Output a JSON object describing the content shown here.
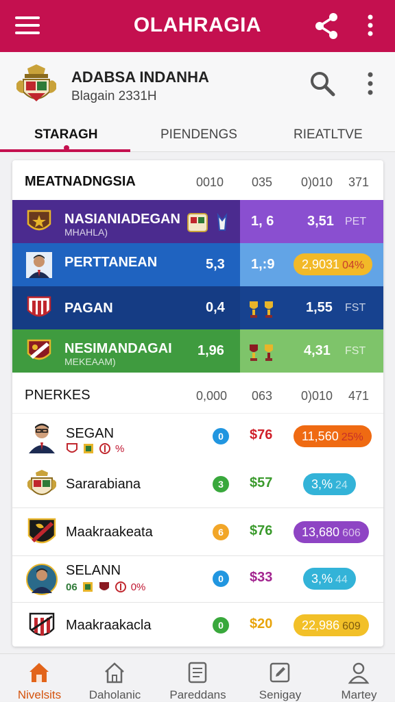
{
  "app_bar": {
    "title": "OLAHRAGIA",
    "icons": [
      "menu-icon",
      "share-icon",
      "more-vert-icon"
    ]
  },
  "profile": {
    "name": "ADABSA INDANHA",
    "subtitle": "Blagain 2331H",
    "icons": [
      "crest-icon",
      "search-icon",
      "more-vert-icon"
    ]
  },
  "tabs": [
    {
      "label": "STARAGH",
      "active": true
    },
    {
      "label": "PIENDENGS",
      "active": false
    },
    {
      "label": "RIEATLTVE",
      "active": false
    }
  ],
  "teams_section": {
    "header": "MEATNADNGSIA",
    "cols": [
      "0010",
      "035",
      "0)010",
      "371"
    ],
    "rows": [
      {
        "name": "NASIANIADEGAN",
        "sub": "MHAHLA)",
        "v1": "",
        "v2": "1, 6",
        "v3": "3,51",
        "v4": "PET",
        "color_left": "#4b2b8f",
        "color_right": "#8a4fd0"
      },
      {
        "name": "PERTTANEAN",
        "sub": "",
        "v1": "5,3",
        "v2": "1,:9",
        "v3": "2,9031",
        "v4": "04%",
        "color_left": "#1f63c0",
        "color_right": "#62a4e6"
      },
      {
        "name": "PAGAN",
        "sub": "",
        "v1": "0,4",
        "v2": "",
        "v3": "1,55",
        "v4": "FST",
        "color_left": "#153c84",
        "color_right": "#17428f"
      },
      {
        "name": "NESIMANDAGAI",
        "sub": "MEKEAAM)",
        "v1": "1,96",
        "v2": "",
        "v3": "4,31",
        "v4": "FST",
        "color_left": "#3f9b3f",
        "color_right": "#7ec46a"
      }
    ]
  },
  "players_section": {
    "header": "PNERKES",
    "cols": [
      "0,000",
      "063",
      "0)010",
      "471"
    ],
    "rows": [
      {
        "name": "SEGAN",
        "extras": "%",
        "circle": "0",
        "circle_color": "#2196e0",
        "money": "$76",
        "money_color": "#d0202a",
        "pill_a": "11,560",
        "pill_b": "25%",
        "pill_color": "#ef6a12"
      },
      {
        "name": "Sararabiana",
        "extras": "",
        "circle": "3",
        "circle_color": "#39a83c",
        "money": "$57",
        "money_color": "#3a9a2c",
        "pill_a": "3,%",
        "pill_b": "24",
        "pill_color": "#33b3d8"
      },
      {
        "name": "Maakraakeata",
        "extras": "",
        "circle": "6",
        "circle_color": "#f2a628",
        "money": "$76",
        "money_color": "#3a9a2c",
        "pill_a": "13,680",
        "pill_b": "606",
        "pill_color": "#8e44c4"
      },
      {
        "name": "SELANN",
        "extras": "0%",
        "circle": "0",
        "circle_color": "#2196e0",
        "money": "$33",
        "money_color": "#a2248f",
        "pill_a": "3,%",
        "pill_b": "44",
        "pill_color": "#33b3d8"
      },
      {
        "name": "Maakraakacla",
        "extras": "",
        "circle": "0",
        "circle_color": "#39a83c",
        "money": "$20",
        "money_color": "#e8a40c",
        "pill_a": "22,986",
        "pill_b": "609",
        "pill_color": "#f2c028"
      }
    ],
    "extra_prefixes": [
      "06"
    ]
  },
  "bottom_nav": [
    {
      "label": "Nivelsits",
      "icon": "home-icon",
      "active": true
    },
    {
      "label": "Daholanic",
      "icon": "home-outline-icon",
      "active": false
    },
    {
      "label": "Pareddans",
      "icon": "list-icon",
      "active": false
    },
    {
      "label": "Senigay",
      "icon": "edit-icon",
      "active": false
    },
    {
      "label": "Martey",
      "icon": "person-icon",
      "active": false
    }
  ],
  "colors": {
    "brand": "#c4104f",
    "active_nav": "#d4520c"
  }
}
